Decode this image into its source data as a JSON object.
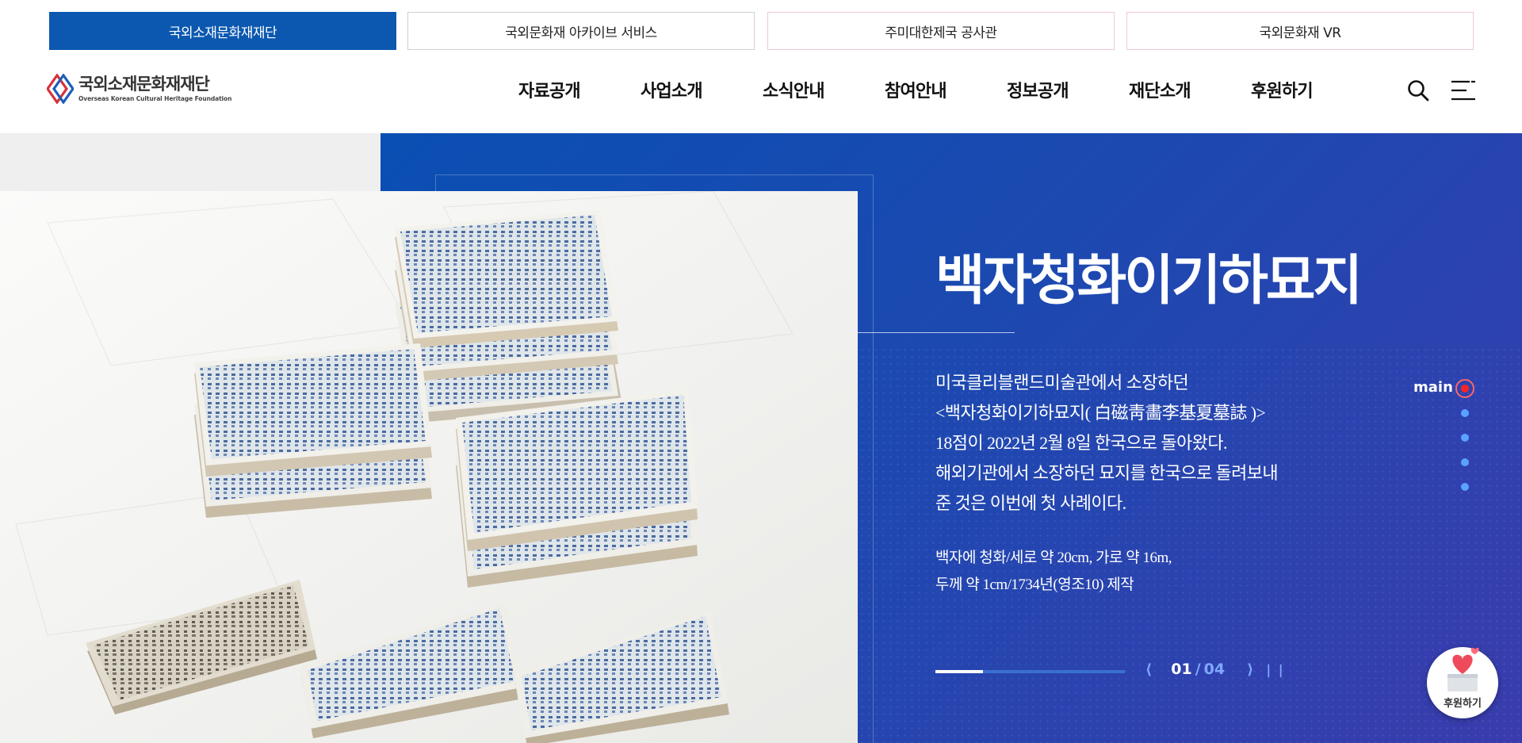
{
  "top_links": [
    {
      "label": "국외소재문화재재단",
      "active": true
    },
    {
      "label": "국외문화재 아카이브 서비스",
      "active": false
    },
    {
      "label": "주미대한제국 공사관",
      "active": false
    },
    {
      "label": "국외문화재 VR",
      "active": false
    }
  ],
  "header": {
    "logo_ko": "국외소재문화재재단",
    "logo_en": "Overseas Korean Cultural Heritage Foundation",
    "nav": [
      "자료공개",
      "사업소개",
      "소식안내",
      "참여안내",
      "정보공개",
      "재단소개",
      "후원하기"
    ],
    "search_icon": "search-icon",
    "menu_icon": "hamburger-menu-icon"
  },
  "hero": {
    "title": "백자청화이기하묘지",
    "description": [
      "미국클리블랜드미술관에서 소장하던",
      "<백자청화이기하묘지( 白磁靑畵李基夏墓誌 )>",
      "18점이 2022년 2월 8일 한국으로 돌아왔다.",
      "해외기관에서 소장하던 묘지를 한국으로 돌려보내",
      "준 것은 이번에 첫 사례이다."
    ],
    "spec": [
      "백자에 청화/세로 약 20cm, 가로 약 16m,",
      "두께 약 1cm/1734년(영조10) 제작"
    ],
    "slide_current": "01",
    "slide_separator": "/",
    "slide_total": "04",
    "progress_fraction": 0.25,
    "prev_icon": "chevron-left-icon",
    "next_icon": "chevron-right-icon",
    "pause_icon": "pause-icon"
  },
  "side_nav": {
    "label": "main",
    "active_index": 0,
    "dot_count": 5
  },
  "donate_float": {
    "label": "후원하기",
    "icon": "heart-gift-icon"
  },
  "colors": {
    "brand_blue": "#0c58b0",
    "hero_gradient_start": "#0a4fb3",
    "hero_gradient_end": "#3a3cae",
    "active_dot": "#ff2424",
    "inactive_dot": "#5aa2ff"
  }
}
